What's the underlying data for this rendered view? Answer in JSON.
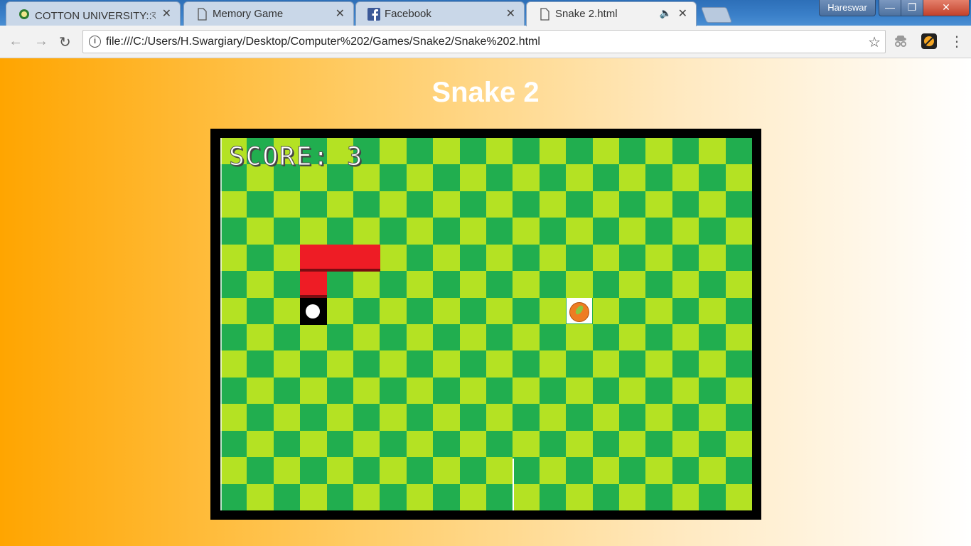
{
  "browser": {
    "tabs": [
      {
        "title": "COTTON UNIVERSITY::কট",
        "icon": "cotton-university-icon",
        "active": false
      },
      {
        "title": "Memory Game",
        "icon": "page-icon",
        "active": false
      },
      {
        "title": "Facebook",
        "icon": "facebook-icon",
        "active": false
      },
      {
        "title": "Snake 2.html",
        "icon": "page-icon",
        "active": true,
        "audio": true
      }
    ],
    "user": "Hareswar",
    "url": "file:///C:/Users/H.Swargiary/Desktop/Computer%202/Games/Snake2/Snake%202.html"
  },
  "page": {
    "title": "Snake 2"
  },
  "game": {
    "score_label": "SCORE: 3",
    "score": 3,
    "grid": {
      "cols": 20,
      "rows": 14
    },
    "colors": {
      "light": "#b4e223",
      "dark": "#21ae4f",
      "snake": "#ee1c25",
      "frame": "#000000"
    },
    "snake": [
      {
        "col": 3,
        "row": 6,
        "part": "head"
      },
      {
        "col": 3,
        "row": 5,
        "part": "body"
      },
      {
        "col": 3,
        "row": 4,
        "part": "body"
      },
      {
        "col": 4,
        "row": 4,
        "part": "body"
      },
      {
        "col": 5,
        "row": 4,
        "part": "body"
      }
    ],
    "food": {
      "col": 13,
      "row": 6,
      "icon": "orange-fruit-icon"
    }
  }
}
